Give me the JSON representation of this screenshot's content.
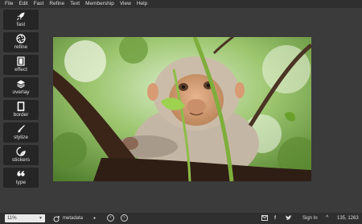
{
  "menu": [
    "File",
    "Edit",
    "Fast",
    "Refine",
    "Text",
    "Membership",
    "View",
    "Help"
  ],
  "tools": [
    {
      "label": "fast",
      "icon": "rocket-icon"
    },
    {
      "label": "refine",
      "icon": "aperture-icon"
    },
    {
      "label": "effect",
      "icon": "film-icon"
    },
    {
      "label": "overlay",
      "icon": "layers-icon"
    },
    {
      "label": "border",
      "icon": "border-frame-icon"
    },
    {
      "label": "stylize",
      "icon": "brush-icon"
    },
    {
      "label": "stickers",
      "icon": "sticker-icon"
    },
    {
      "label": "type",
      "icon": "quote-icon"
    }
  ],
  "statusbar": {
    "zoom": "11%",
    "metadata": "metadata",
    "sign_in": "Sign In",
    "coords": "135, 1263"
  },
  "colors": {
    "background": "#3b3b3b",
    "bars": "#2f2f2f",
    "tool_button": "#252525"
  }
}
